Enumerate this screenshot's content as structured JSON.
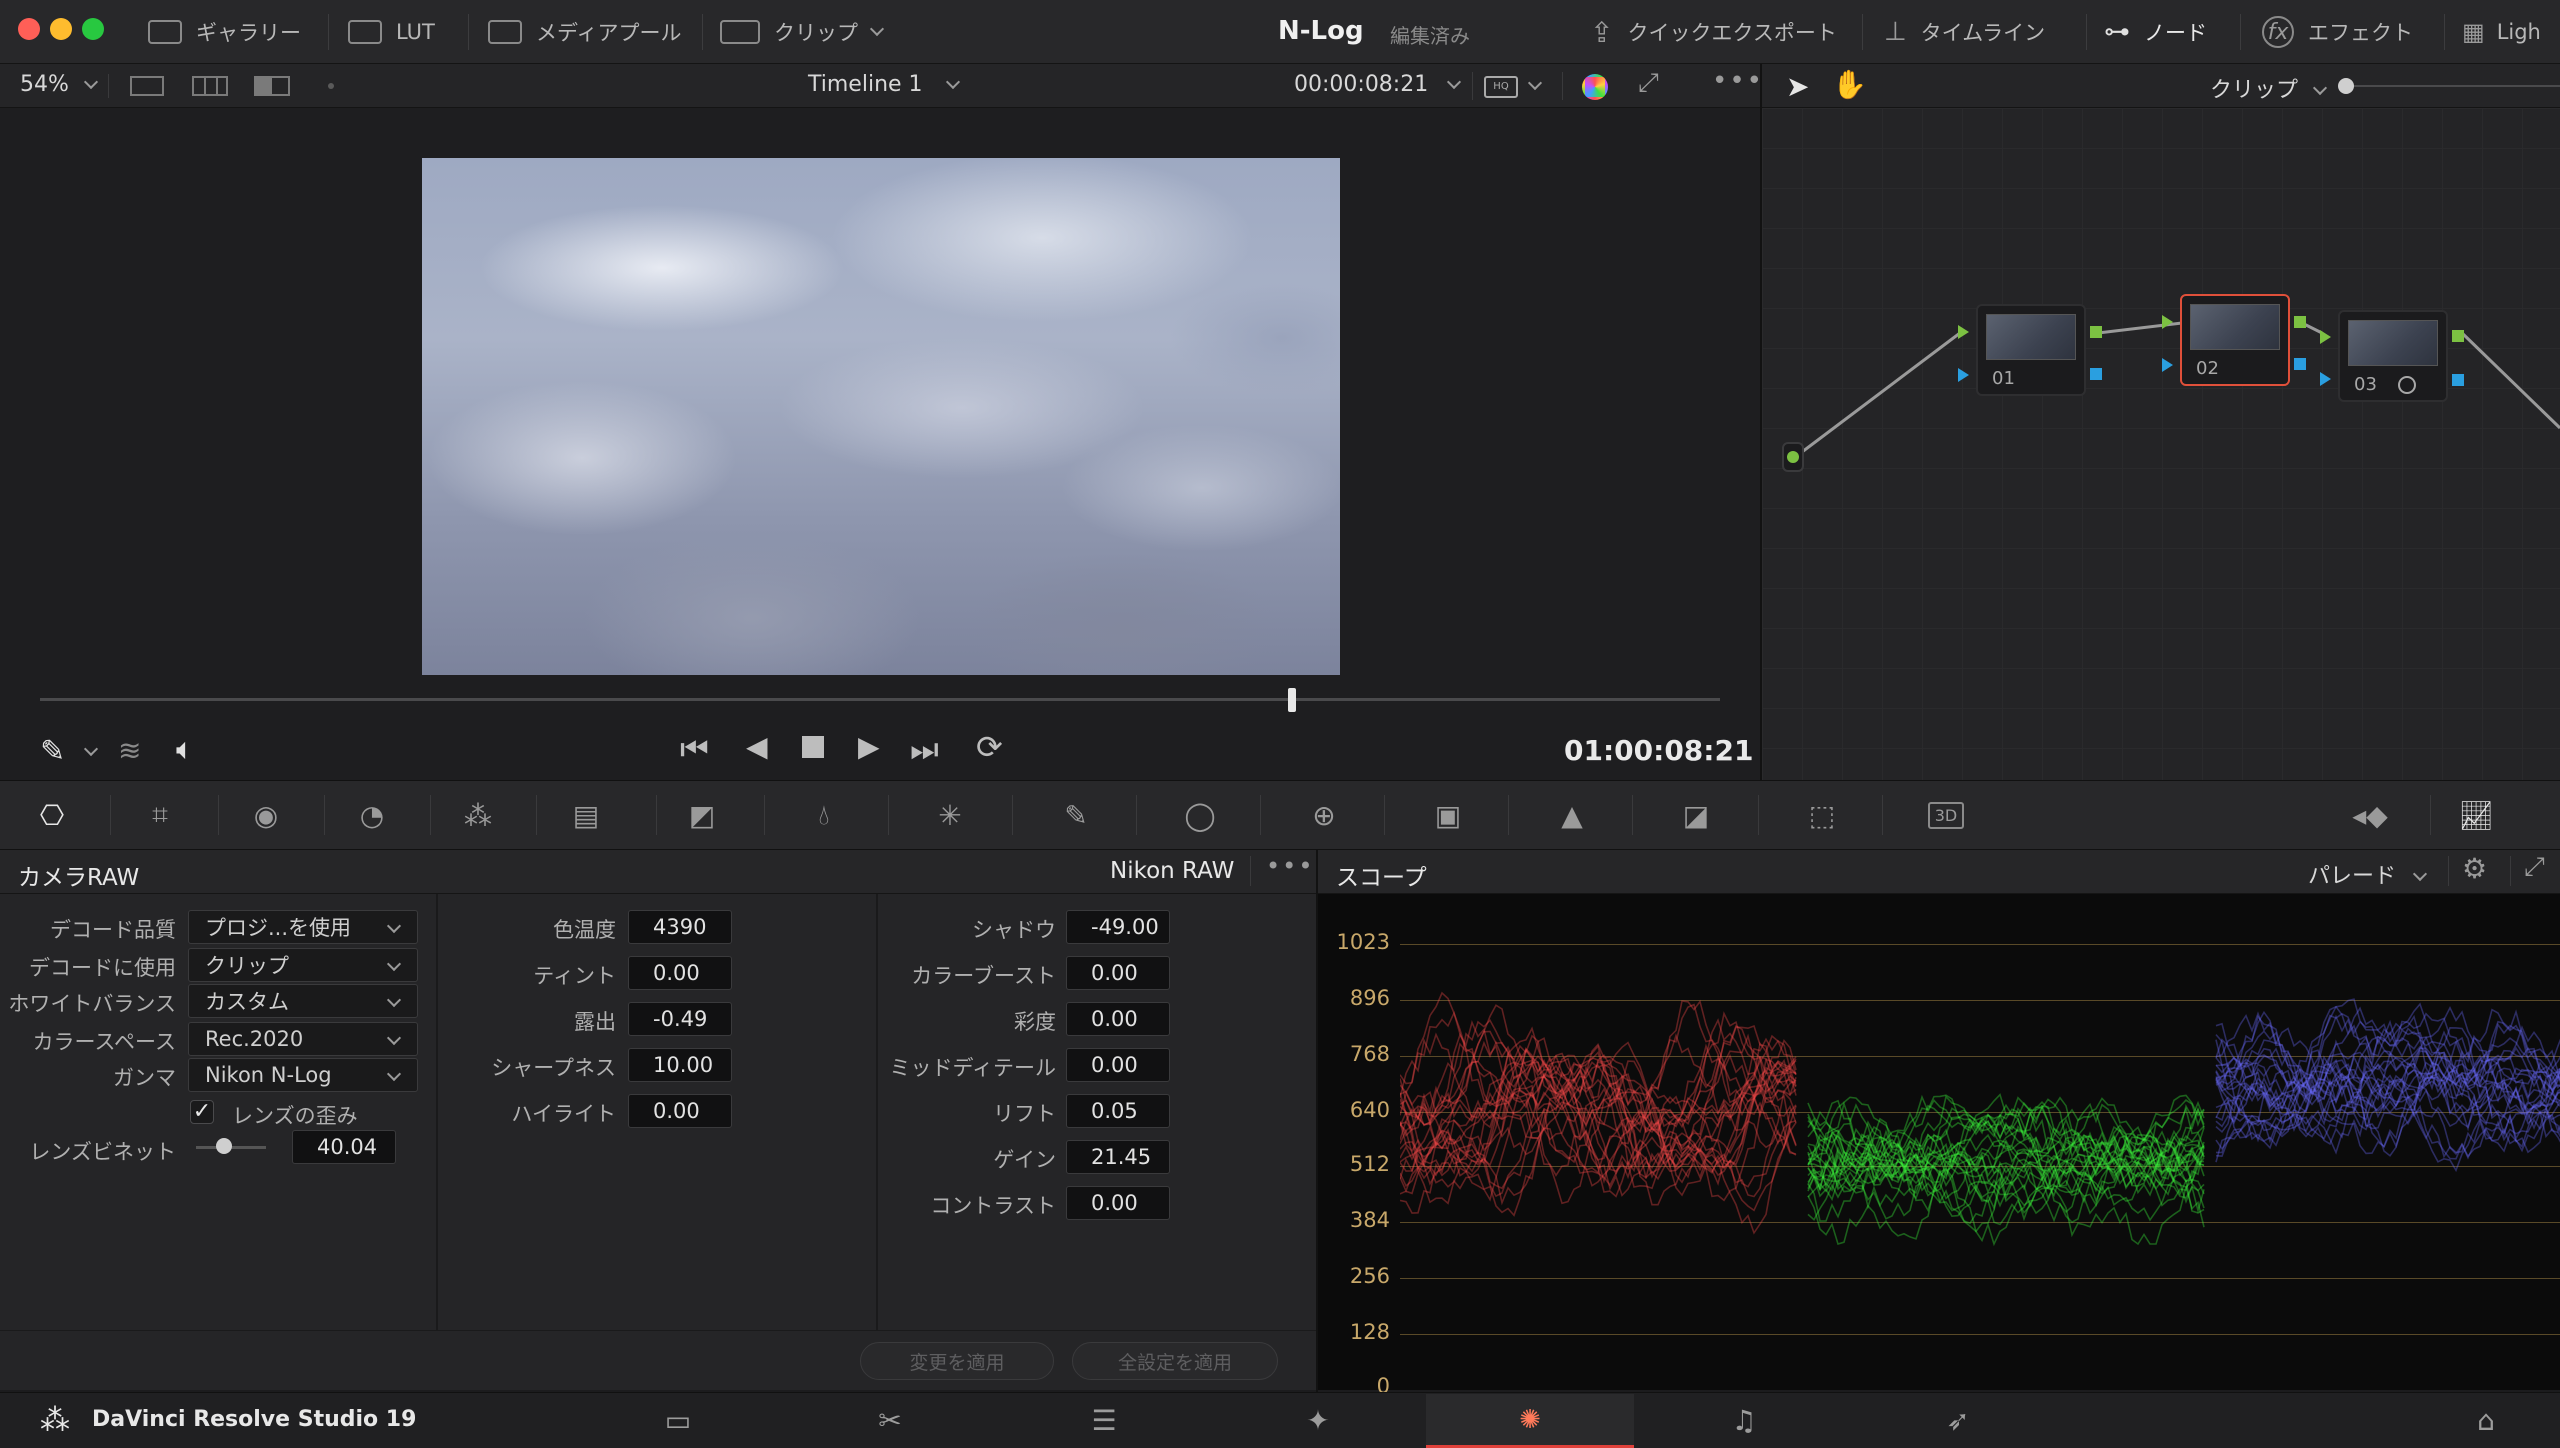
{
  "topbar": {
    "gallery": "ギャラリー",
    "lut": "LUT",
    "media_pool": "メディアプール",
    "clip": "クリップ",
    "project_title": "N-Log",
    "edited": "編集済み",
    "quick_export": "クイックエクスポート",
    "timeline": "タイムライン",
    "nodes": "ノード",
    "effects": "エフェクト",
    "lightbox": "Ligh"
  },
  "viewer": {
    "zoom": "54%",
    "timeline_name": "Timeline 1",
    "source_timecode": "00:00:08:21",
    "record_timecode": "01:00:08:21",
    "playhead_fraction": 0.745
  },
  "node_toolbar": {
    "clip_label": "クリップ"
  },
  "nodes": [
    {
      "label": "01",
      "selected": false
    },
    {
      "label": "02",
      "selected": true
    },
    {
      "label": "03",
      "selected": false
    }
  ],
  "camera_raw": {
    "title": "カメラRAW",
    "format": "Nikon RAW",
    "decode": [
      {
        "label": "デコード品質",
        "value": "プロジ...を使用"
      },
      {
        "label": "デコードに使用",
        "value": "クリップ"
      },
      {
        "label": "ホワイトバランス",
        "value": "カスタム"
      },
      {
        "label": "カラースペース",
        "value": "Rec.2020"
      },
      {
        "label": "ガンマ",
        "value": "Nikon N-Log"
      }
    ],
    "lens_distortion_label": "レンズの歪み",
    "lens_distortion_checked": true,
    "vignette_label": "レンズビネット",
    "vignette_value": "40.04",
    "col2": [
      {
        "label": "色温度",
        "value": "4390"
      },
      {
        "label": "ティント",
        "value": "0.00"
      },
      {
        "label": "露出",
        "value": "-0.49"
      },
      {
        "label": "シャープネス",
        "value": "10.00"
      },
      {
        "label": "ハイライト",
        "value": "0.00"
      }
    ],
    "col3": [
      {
        "label": "シャドウ",
        "value": "-49.00"
      },
      {
        "label": "カラーブースト",
        "value": "0.00"
      },
      {
        "label": "彩度",
        "value": "0.00"
      },
      {
        "label": "ミッドディテール",
        "value": "0.00"
      },
      {
        "label": "リフト",
        "value": "0.05"
      },
      {
        "label": "ゲイン",
        "value": "21.45"
      },
      {
        "label": "コントラスト",
        "value": "0.00"
      }
    ],
    "apply_changes": "変更を適用",
    "apply_all": "全設定を適用"
  },
  "scope": {
    "title": "スコープ",
    "mode": "パレード",
    "ticks": [
      "1023",
      "896",
      "768",
      "640",
      "512",
      "384",
      "256",
      "128",
      "0"
    ],
    "colors": {
      "red": "#ff4a4a",
      "green": "#3cff3c",
      "blue": "#6a6aff"
    }
  },
  "bottombar": {
    "app_name": "DaVinci Resolve Studio 19",
    "active_page": "color"
  }
}
